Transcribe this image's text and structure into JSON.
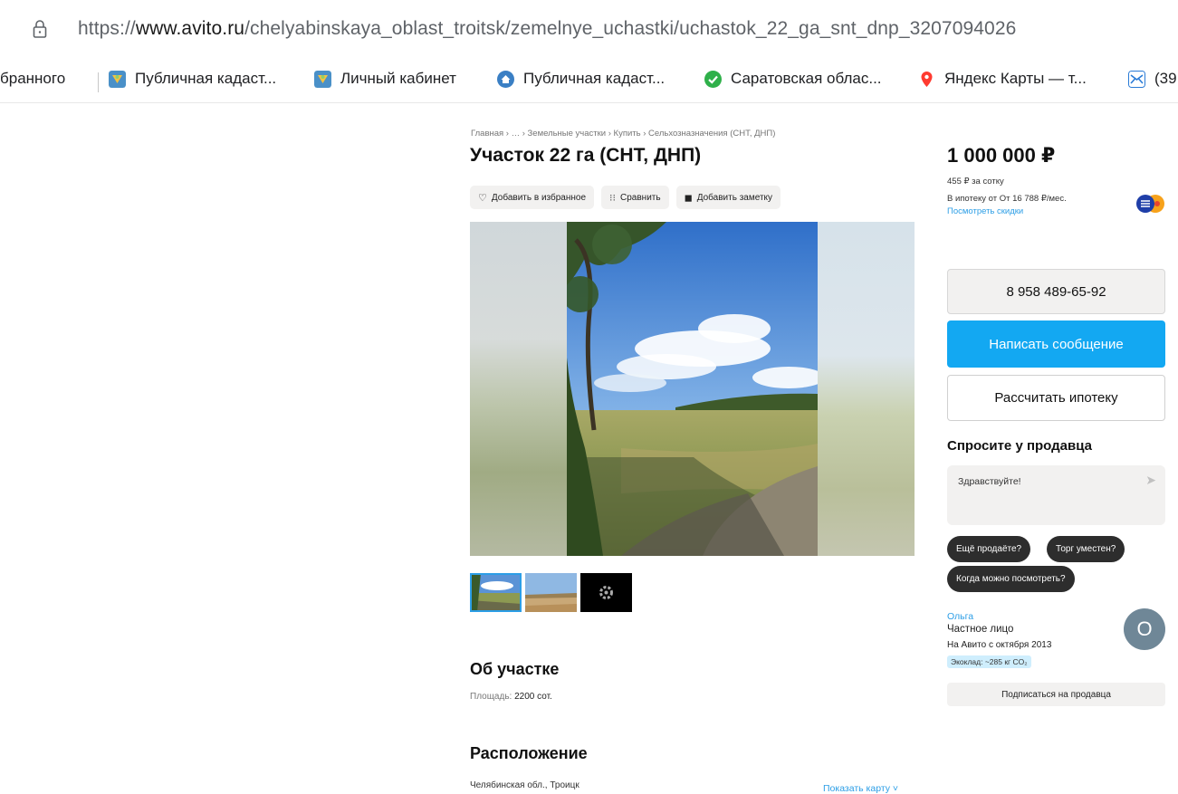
{
  "browser": {
    "url_prefix": "https://",
    "url_domain": "www.avito.ru",
    "url_path": "/chelyabinskaya_oblast_troitsk/zemelnye_uchastki/uchastok_22_ga_snt_dnp_3207094026",
    "bookmarks": [
      {
        "label": "бранного",
        "icon": "none"
      },
      {
        "label": "Публичная кадаст...",
        "icon": "rosreestr-icon"
      },
      {
        "label": "Личный кабинет",
        "icon": "rosreestr-icon"
      },
      {
        "label": "Публичная кадаст...",
        "icon": "home-icon"
      },
      {
        "label": "Саратовская облас...",
        "icon": "check-icon"
      },
      {
        "label": "Яндекс Карты — т...",
        "icon": "map-pin-icon"
      },
      {
        "label": "(39",
        "icon": "mail-icon"
      }
    ]
  },
  "listing": {
    "breadcrumb": "Главная › … › Земельные участки › Купить › Сельхозназначения (СНТ, ДНП)",
    "title": "Участок 22 га (СНТ, ДНП)",
    "actions": {
      "favorite": "Добавить в избранное",
      "compare": "Сравнить",
      "note": "Добавить заметку"
    },
    "about_title": "Об участке",
    "area_label": "Площадь:",
    "area_value": "2200 сот.",
    "location_title": "Расположение",
    "location_address": "Челябинская обл., Троицк",
    "show_map": "Показать карту ˅"
  },
  "sidebar": {
    "price": "1 000 000 ₽",
    "price_per": "455 ₽ за сотку",
    "mortgage": "В ипотеку от От 16 788 ₽/мес.",
    "discounts": "Посмотреть скидки",
    "phone": "8 958 489-65-92",
    "write_message": "Написать сообщение",
    "calc_mortgage": "Рассчитать ипотеку",
    "ask_title": "Спросите у продавца",
    "message_text": "Здравствуйте!",
    "chips": [
      "Ещё продаёте?",
      "Торг уместен?",
      "Когда можно посмотреть?"
    ],
    "seller_name": "Ольга",
    "seller_type": "Частное лицо",
    "seller_since": "На Авито с октября 2013",
    "eco": "Экоклад: ~285 кг CO₂",
    "avatar_letter": "О",
    "subscribe": "Подписаться на продавца"
  },
  "colors": {
    "accent_blue": "#13a8f2",
    "link_blue": "#2c9ee6",
    "chip_dark": "#2d2d2d",
    "avatar_gray": "#6f8797"
  }
}
